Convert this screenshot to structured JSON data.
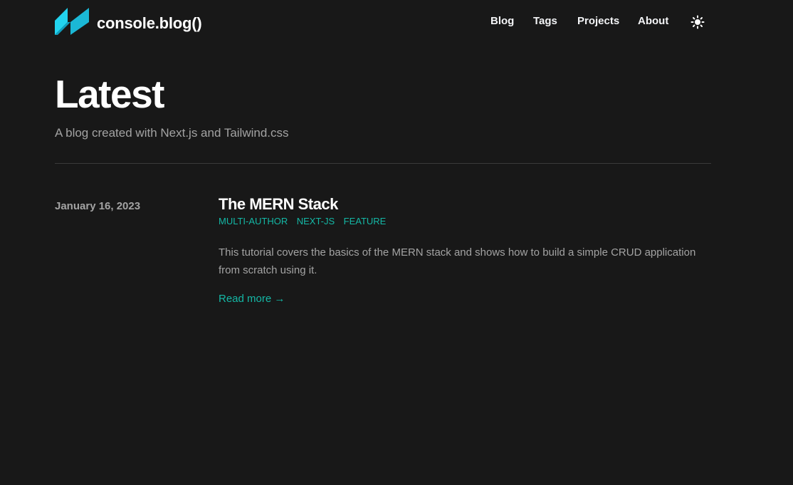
{
  "header": {
    "site_title": "console.blog()",
    "logo_icon": "logo-icon",
    "nav": [
      {
        "label": "Blog"
      },
      {
        "label": "Tags"
      },
      {
        "label": "Projects"
      },
      {
        "label": "About"
      }
    ],
    "theme_toggle_icon": "sun-icon"
  },
  "main": {
    "title": "Latest",
    "subtitle": "A blog created with Next.js and Tailwind.css",
    "posts": [
      {
        "date": "January 16, 2023",
        "title": "The MERN Stack",
        "tags": [
          "multi-author",
          "next-js",
          "feature"
        ],
        "summary": "This tutorial covers the basics of the MERN stack and shows how to build a simple CRUD application from scratch using it.",
        "read_more": "Read more →"
      }
    ]
  },
  "colors": {
    "background": "#181818",
    "accent": "#14b8a6",
    "logo_primary": "#22d3ee",
    "logo_secondary": "#0e9fbf"
  }
}
